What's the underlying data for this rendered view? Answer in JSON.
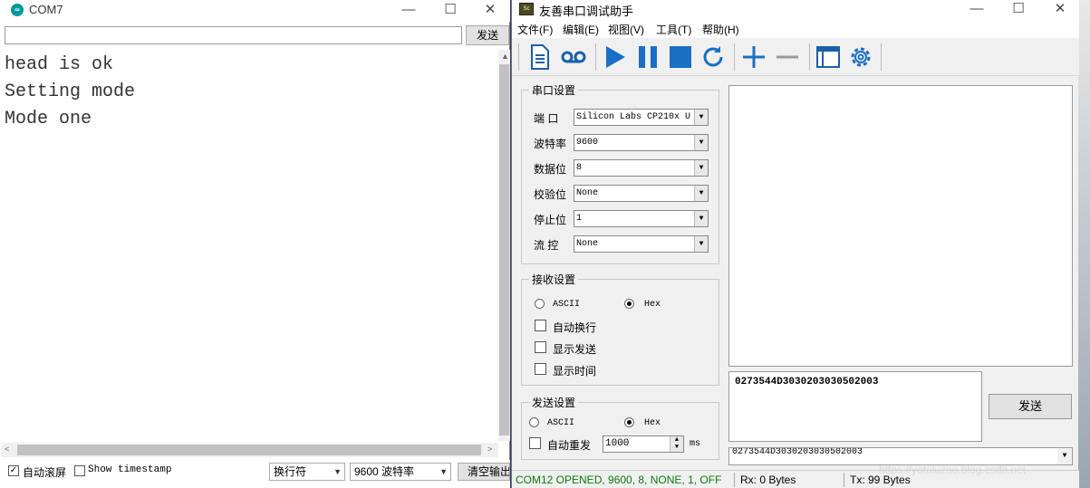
{
  "monitor": {
    "title": "COM7",
    "send_button": "发送",
    "output_lines": [
      "head is ok",
      "Setting mode",
      "Mode one"
    ],
    "autoscroll_label": "自动滚屏",
    "timestamp_label": "Show timestamp",
    "line_ending": "换行符",
    "baud": "9600 波特率",
    "clear_button": "清空输出"
  },
  "assistant": {
    "title": "友善串口调试助手",
    "menu": [
      "文件(F)",
      "编辑(E)",
      "视图(V)",
      "工具(T)",
      "帮助(H)"
    ],
    "serial_settings": {
      "title": "串口设置",
      "port_label": "端 口",
      "port_value": "Silicon Labs CP210x U",
      "baud_label": "波特率",
      "baud_value": "9600",
      "databits_label": "数据位",
      "databits_value": "8",
      "parity_label": "校验位",
      "parity_value": "None",
      "stopbits_label": "停止位",
      "stopbits_value": "1",
      "flow_label": "流 控",
      "flow_value": "None"
    },
    "recv_settings": {
      "title": "接收设置",
      "ascii": "ASCII",
      "hex": "Hex",
      "auto_newline": "自动换行",
      "show_send": "显示发送",
      "show_time": "显示时间"
    },
    "send_settings": {
      "title": "发送设置",
      "ascii": "ASCII",
      "hex": "Hex",
      "auto_resend": "自动重发",
      "interval": "1000",
      "unit": "ms"
    },
    "send_text": "0273544D3030203030502003",
    "send_button": "发送",
    "history_text": "0273544D3030203030502003",
    "status": {
      "port": "COM12 OPENED, 9600, 8, NONE, 1, OFF",
      "rx": "Rx: 0 Bytes",
      "tx": "Tx: 99 Bytes"
    }
  },
  "watermark": "https://yotaluzao.blog.csdn.net",
  "colors": {
    "play_blue": "#1a6fc4",
    "status_green": "#0b7a0b"
  }
}
